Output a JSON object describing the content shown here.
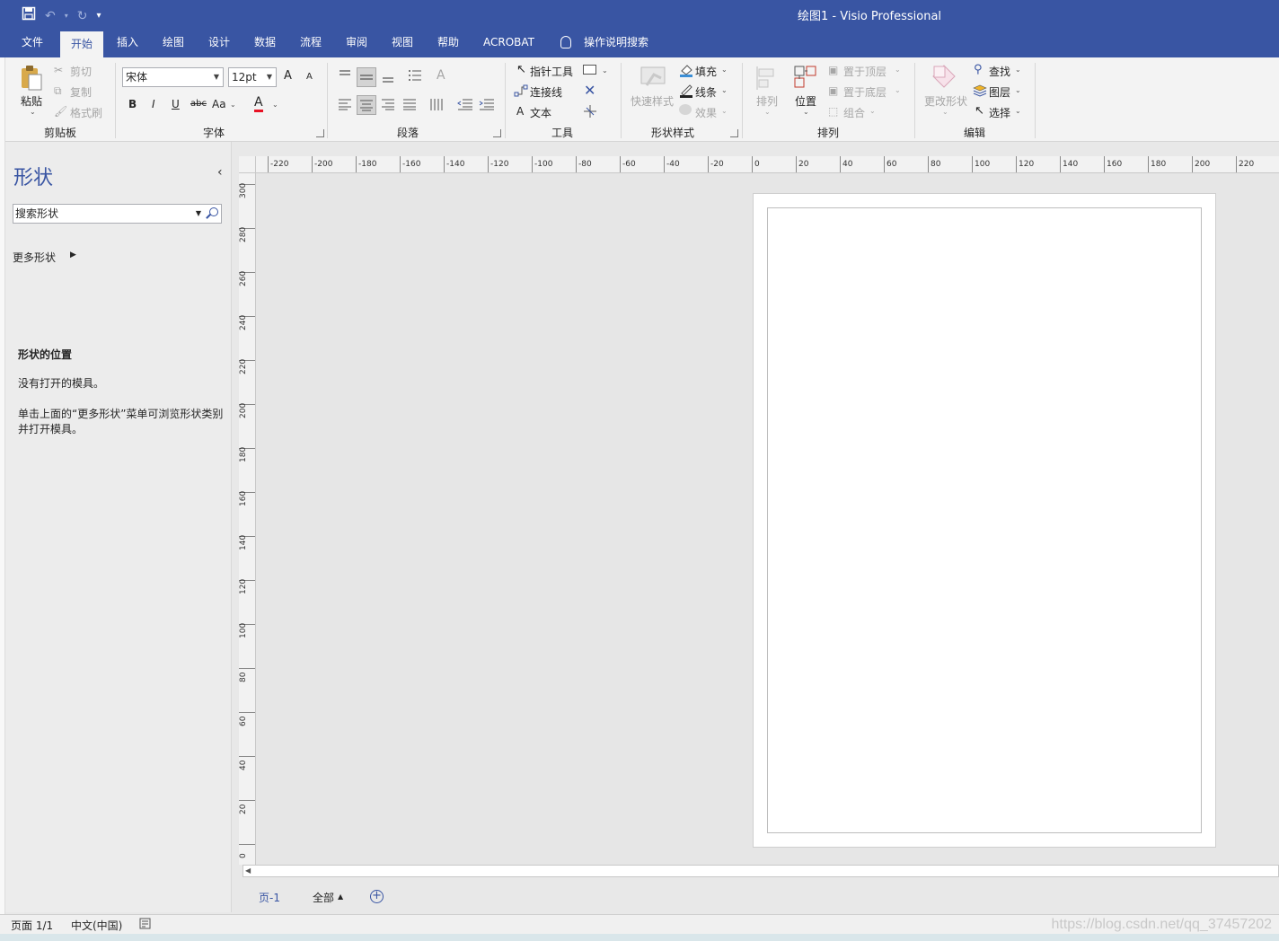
{
  "window": {
    "title": "绘图1  -  Visio Professional"
  },
  "quick_access": {
    "save_icon": "save-icon",
    "undo_icon": "undo-icon",
    "redo_icon": "redo-icon",
    "customize_icon": "customize-qat-icon"
  },
  "menu": {
    "tabs": [
      "文件",
      "开始",
      "插入",
      "绘图",
      "设计",
      "数据",
      "流程",
      "审阅",
      "视图",
      "帮助",
      "ACROBAT"
    ],
    "active": "开始",
    "tell_me": "操作说明搜索"
  },
  "ribbon": {
    "clipboard": {
      "label": "剪贴板",
      "paste": "粘贴",
      "cut": "剪切",
      "copy": "复制",
      "format_painter": "格式刷"
    },
    "font": {
      "label": "字体",
      "font_name": "宋体",
      "font_size": "12pt",
      "bold": "B",
      "italic": "I",
      "underline": "U",
      "strike": "abc",
      "case": "Aa",
      "grow": "A",
      "shrink": "A",
      "color": "A",
      "font_color": "#e81123"
    },
    "paragraph": {
      "label": "段落"
    },
    "tools": {
      "label": "工具",
      "pointer": "指针工具",
      "connector": "连接线",
      "text": "文本",
      "text_prefix": "A"
    },
    "shape_styles": {
      "label": "形状样式",
      "quick_styles": "快速样式",
      "fill": "填充",
      "line": "线条",
      "effects": "效果"
    },
    "arrange": {
      "label": "排列",
      "align": "排列",
      "position": "位置",
      "bring_front": "置于顶层",
      "send_back": "置于底层",
      "group": "组合"
    },
    "editing": {
      "label": "编辑",
      "change_shape": "更改形状",
      "find": "查找",
      "layers": "图层",
      "select": "选择"
    }
  },
  "shapes_panel": {
    "title": "形状",
    "search_placeholder": "搜索形状",
    "more_shapes": "更多形状",
    "heading": "形状的位置",
    "no_stencil": "没有打开的模具。",
    "hint": "单击上面的“更多形状”菜单可浏览形状类别并打开模具。"
  },
  "ruler": {
    "h": [
      "-220",
      "-200",
      "-180",
      "-160",
      "-140",
      "-120",
      "-100",
      "-80",
      "-60",
      "-40",
      "-20",
      "0",
      "20",
      "40",
      "60",
      "80",
      "100",
      "120",
      "140",
      "160",
      "180",
      "200",
      "220"
    ],
    "v": [
      "300",
      "280",
      "260",
      "240",
      "220",
      "200",
      "180",
      "160",
      "140",
      "120",
      "100",
      "80",
      "60",
      "40",
      "20",
      "0"
    ]
  },
  "page_tabs": {
    "page": "页-1",
    "all": "全部",
    "add_icon": "add-page-icon"
  },
  "status": {
    "page": "页面 1/1",
    "language": "中文(中国)",
    "macro_icon": "macro-recording-icon"
  },
  "watermark": "https://blog.csdn.net/qq_37457202",
  "colors": {
    "accent": "#3955a3"
  }
}
